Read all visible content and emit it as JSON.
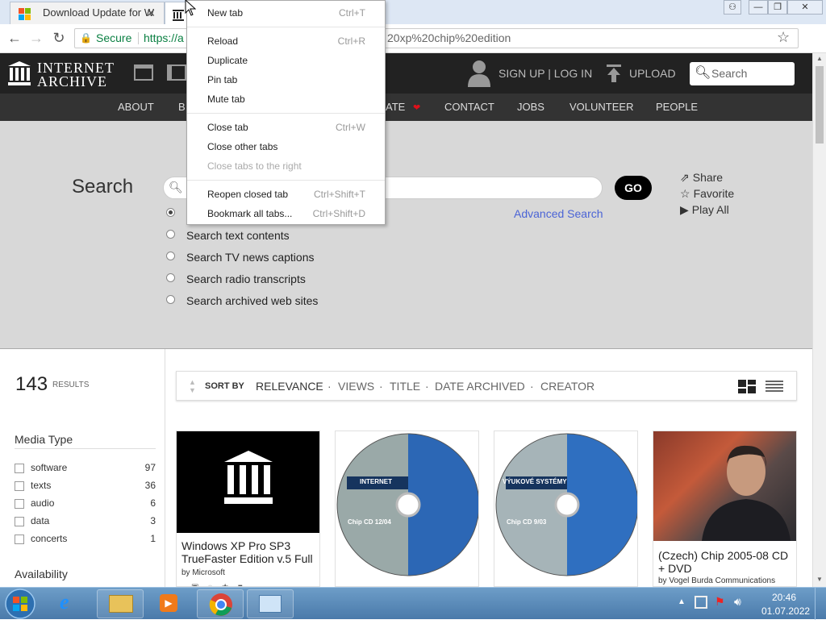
{
  "browser": {
    "tabs": [
      {
        "title": "Download Update for W",
        "active": false
      },
      {
        "title": "",
        "active": true
      }
    ],
    "window_controls": {
      "user": "⚇",
      "minimize": "—",
      "restore": "❐",
      "close": "✕"
    },
    "address": {
      "secure_label": "Secure",
      "url_start": "https://a",
      "url_end": "20xp%20chip%20edition"
    },
    "star_icon": "☆"
  },
  "context_menu": {
    "items": [
      {
        "label": "New tab",
        "shortcut": "Ctrl+T",
        "disabled": false
      },
      {
        "label": "Reload",
        "shortcut": "Ctrl+R",
        "disabled": false
      },
      {
        "label": "Duplicate",
        "shortcut": "",
        "disabled": false
      },
      {
        "label": "Pin tab",
        "shortcut": "",
        "disabled": false
      },
      {
        "label": "Mute tab",
        "shortcut": "",
        "disabled": false
      },
      {
        "label": "Close tab",
        "shortcut": "Ctrl+W",
        "disabled": false
      },
      {
        "label": "Close other tabs",
        "shortcut": "",
        "disabled": false
      },
      {
        "label": "Close tabs to the right",
        "shortcut": "",
        "disabled": true
      },
      {
        "label": "Reopen closed tab",
        "shortcut": "Ctrl+Shift+T",
        "disabled": false
      },
      {
        "label": "Bookmark all tabs...",
        "shortcut": "Ctrl+Shift+D",
        "disabled": false
      }
    ]
  },
  "ia_header": {
    "logo_line1": "INTERNET",
    "logo_line2": "ARCHIVE",
    "signup_login": "SIGN UP | LOG IN",
    "upload": "UPLOAD",
    "search_placeholder": "Search"
  },
  "ia_nav": {
    "items": [
      "ABOUT",
      "B",
      "ATE",
      "CONTACT",
      "JOBS",
      "VOLUNTEER",
      "PEOPLE"
    ]
  },
  "search_panel": {
    "heading": "Search",
    "go_label": "GO",
    "advanced": "Advanced Search",
    "options": [
      "Search text contents",
      "Search TV news captions",
      "Search radio transcripts",
      "Search archived web sites"
    ],
    "actions": [
      "Share",
      "Favorite",
      "Play All"
    ]
  },
  "results": {
    "count": "143",
    "label": "RESULTS"
  },
  "facets": {
    "media_type_title": "Media Type",
    "media_types": [
      {
        "label": "software",
        "count": "97"
      },
      {
        "label": "texts",
        "count": "36"
      },
      {
        "label": "audio",
        "count": "6"
      },
      {
        "label": "data",
        "count": "3"
      },
      {
        "label": "concerts",
        "count": "1"
      }
    ],
    "availability_title": "Availability"
  },
  "sort": {
    "label": "SORT BY",
    "options": [
      "RELEVANCE",
      "VIEWS",
      "TITLE",
      "DATE ARCHIVED",
      "CREATOR"
    ]
  },
  "items": [
    {
      "title": "Windows XP Pro SP3 TrueFaster Edition v.5 Full",
      "by": "by Microsoft"
    },
    {
      "title": "",
      "by": "",
      "disc_label": "Chip CD 12/04",
      "disc_band": "INTERNET"
    },
    {
      "title": "",
      "by": "",
      "disc_label": "Chip CD 9/03",
      "disc_band": "VÝUKOVÉ SYSTÉMY"
    },
    {
      "title": "(Czech) Chip 2005-08 CD + DVD",
      "by": "by Vogel Burda Communications"
    }
  ],
  "taskbar": {
    "time": "20:46",
    "date": "01.07.2022"
  },
  "colors": {
    "ia_header": "#222222",
    "ia_nav": "#333333",
    "search_band": "#d8d8d8",
    "advanced_link": "#4b64d6",
    "heart": "#e0101a",
    "taskbar": "#5a8ab8"
  }
}
